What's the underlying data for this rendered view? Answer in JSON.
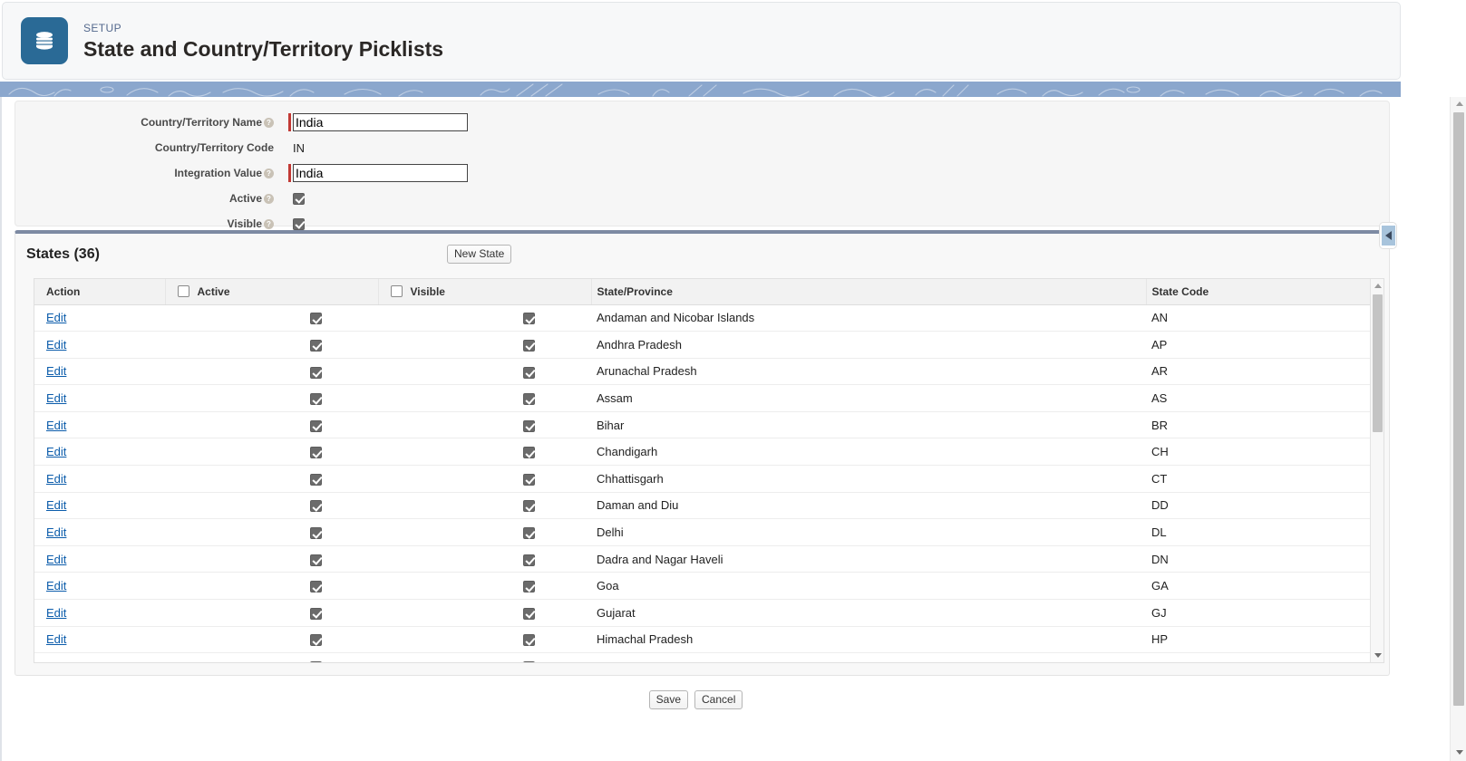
{
  "header": {
    "eyebrow": "SETUP",
    "title": "State and Country/Territory Picklists",
    "app_icon": "database-icon"
  },
  "detail_form": {
    "fields": [
      {
        "label": "Country/Territory Name",
        "help": "?",
        "required": true,
        "type": "text",
        "value": "India"
      },
      {
        "label": "Country/Territory Code",
        "help": "",
        "required": false,
        "type": "static",
        "value": "IN"
      },
      {
        "label": "Integration Value",
        "help": "?",
        "required": true,
        "type": "text",
        "value": "India"
      },
      {
        "label": "Active",
        "help": "?",
        "required": false,
        "type": "checkbox",
        "checked": true
      },
      {
        "label": "Visible",
        "help": "?",
        "required": false,
        "type": "checkbox",
        "checked": true
      }
    ]
  },
  "collapse_tab": {
    "icon": "chevron-left-icon"
  },
  "states_section": {
    "title": "States (36)",
    "count": 36,
    "new_button": "New State",
    "columns": [
      "Action",
      "Active",
      "Visible",
      "State/Province",
      "State Code"
    ],
    "header_checkboxes": {
      "active": false,
      "visible": false
    },
    "edit_label": "Edit",
    "rows": [
      {
        "action": "Edit",
        "active": true,
        "visible": true,
        "state": "Andaman and Nicobar Islands",
        "code": "AN"
      },
      {
        "action": "Edit",
        "active": true,
        "visible": true,
        "state": "Andhra Pradesh",
        "code": "AP"
      },
      {
        "action": "Edit",
        "active": true,
        "visible": true,
        "state": "Arunachal Pradesh",
        "code": "AR"
      },
      {
        "action": "Edit",
        "active": true,
        "visible": true,
        "state": "Assam",
        "code": "AS"
      },
      {
        "action": "Edit",
        "active": true,
        "visible": true,
        "state": "Bihar",
        "code": "BR"
      },
      {
        "action": "Edit",
        "active": true,
        "visible": true,
        "state": "Chandigarh",
        "code": "CH"
      },
      {
        "action": "Edit",
        "active": true,
        "visible": true,
        "state": "Chhattisgarh",
        "code": "CT"
      },
      {
        "action": "Edit",
        "active": true,
        "visible": true,
        "state": "Daman and Diu",
        "code": "DD"
      },
      {
        "action": "Edit",
        "active": true,
        "visible": true,
        "state": "Delhi",
        "code": "DL"
      },
      {
        "action": "Edit",
        "active": true,
        "visible": true,
        "state": "Dadra and Nagar Haveli",
        "code": "DN"
      },
      {
        "action": "Edit",
        "active": true,
        "visible": true,
        "state": "Goa",
        "code": "GA"
      },
      {
        "action": "Edit",
        "active": true,
        "visible": true,
        "state": "Gujarat",
        "code": "GJ"
      },
      {
        "action": "Edit",
        "active": true,
        "visible": true,
        "state": "Himachal Pradesh",
        "code": "HP"
      }
    ]
  },
  "footer": {
    "save_label": "Save",
    "cancel_label": "Cancel"
  },
  "colors": {
    "app_icon_bg": "#2a6a96",
    "eyebrow": "#54698d",
    "required_bar": "#c23934",
    "band": "#8ba7cd",
    "section_top_border": "#7d8aa3",
    "link": "#0b5cab"
  }
}
